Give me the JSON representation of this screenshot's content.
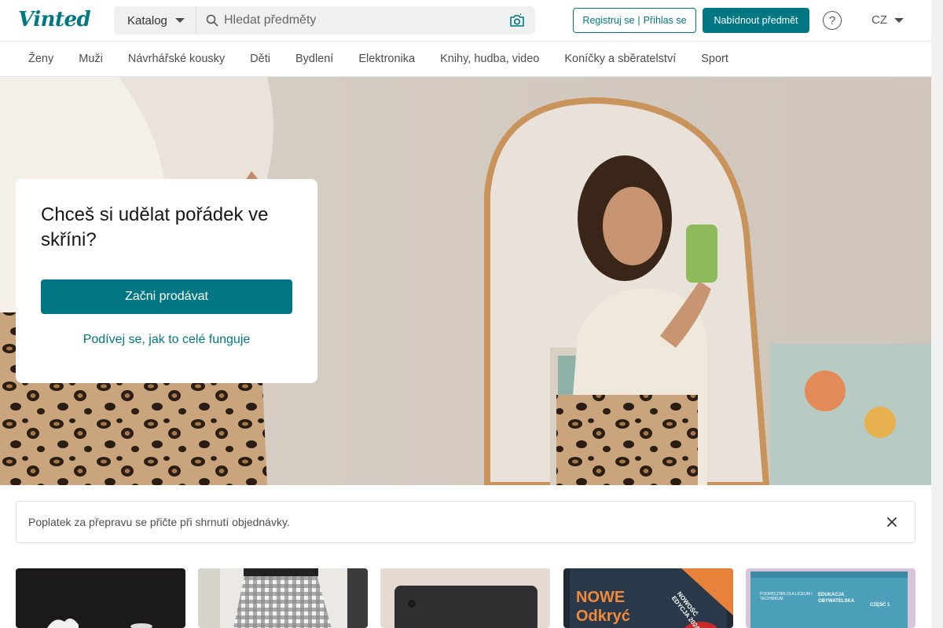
{
  "header": {
    "logo": "Vinted",
    "catalog_label": "Katalog",
    "search_placeholder": "Hledat předměty",
    "register_label": "Registruj se",
    "login_label": "Přihlas se",
    "sell_label": "Nabídnout předmět",
    "help_label": "?",
    "language": "CZ"
  },
  "nav": {
    "items": [
      {
        "label": "Ženy"
      },
      {
        "label": "Muži"
      },
      {
        "label": "Návrhářské kousky"
      },
      {
        "label": "Děti"
      },
      {
        "label": "Bydlení"
      },
      {
        "label": "Elektronika"
      },
      {
        "label": "Knihy, hudba, video"
      },
      {
        "label": "Koníčky a sběratelství"
      },
      {
        "label": "Sport"
      }
    ]
  },
  "hero": {
    "title": "Chceš si udělat pořádek ve skříni?",
    "cta_label": "Začni prodávat",
    "link_label": "Podívej se, jak to celé funguje"
  },
  "notice": {
    "text": "Poplatek za přepravu se přičte při shrnutí objednávky."
  },
  "items": {
    "book1_line1": "NOWE",
    "book1_line2": "Odkryć",
    "book1_badge": "NOWOŚĆ EDYCJA 2024",
    "book2_line1": "PODRĘCZNIK DLA LICEUM I TECHNIKUM",
    "book2_line2": "EDUKACJA OBYWATELSKA",
    "book2_part": "CZĘŚĆ 1"
  },
  "colors": {
    "brand": "#007782",
    "text": "#171717",
    "muted": "#4d4d4d",
    "border": "#e5e5e5"
  }
}
